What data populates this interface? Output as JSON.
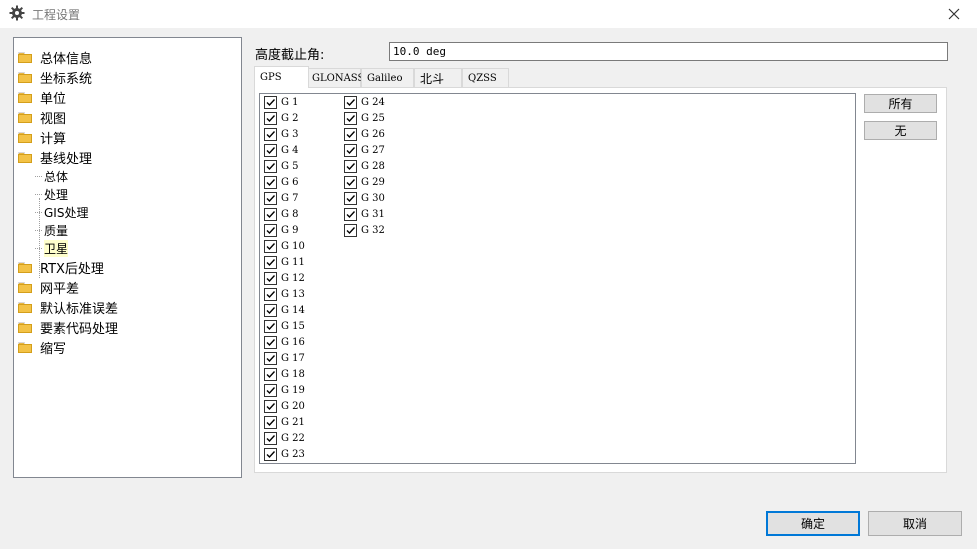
{
  "window": {
    "title": "工程设置",
    "title_icon": "gear-icon",
    "close_icon": "close-icon"
  },
  "tree": {
    "items": [
      {
        "label": "总体信息",
        "type": "folder"
      },
      {
        "label": "坐标系统",
        "type": "folder"
      },
      {
        "label": "单位",
        "type": "folder"
      },
      {
        "label": "视图",
        "type": "folder"
      },
      {
        "label": "计算",
        "type": "folder"
      },
      {
        "label": "基线处理",
        "type": "folder",
        "children": [
          {
            "label": "总体"
          },
          {
            "label": "处理"
          },
          {
            "label": "GIS处理"
          },
          {
            "label": "质量"
          },
          {
            "label": "卫星",
            "selected": true
          }
        ]
      },
      {
        "label": "RTX后处理",
        "type": "folder"
      },
      {
        "label": "网平差",
        "type": "folder"
      },
      {
        "label": "默认标准误差",
        "type": "folder"
      },
      {
        "label": "要素代码处理",
        "type": "folder"
      },
      {
        "label": "缩写",
        "type": "folder"
      }
    ]
  },
  "elevation": {
    "label": "高度截止角:",
    "value": "10.0 deg"
  },
  "tabs": [
    {
      "label": "GPS",
      "active": true
    },
    {
      "label": "GLONASS"
    },
    {
      "label": "Galileo"
    },
    {
      "label": "北斗"
    },
    {
      "label": "QZSS"
    }
  ],
  "satellites": {
    "column1": [
      "G 1",
      "G 2",
      "G 3",
      "G 4",
      "G 5",
      "G 6",
      "G 7",
      "G 8",
      "G 9",
      "G 10",
      "G 11",
      "G 12",
      "G 13",
      "G 14",
      "G 15",
      "G 16",
      "G 17",
      "G 18",
      "G 19",
      "G 20",
      "G 21",
      "G 22",
      "G 23"
    ],
    "column2": [
      "G 24",
      "G 25",
      "G 26",
      "G 27",
      "G 28",
      "G 29",
      "G 30",
      "G 31",
      "G 32"
    ],
    "all_checked": true
  },
  "buttons": {
    "all": "所有",
    "none": "无",
    "ok": "确定",
    "cancel": "取消"
  },
  "colors": {
    "folder": "#f3c246",
    "selected_bg": "#ffffcc",
    "focus_border": "#0078d7"
  }
}
